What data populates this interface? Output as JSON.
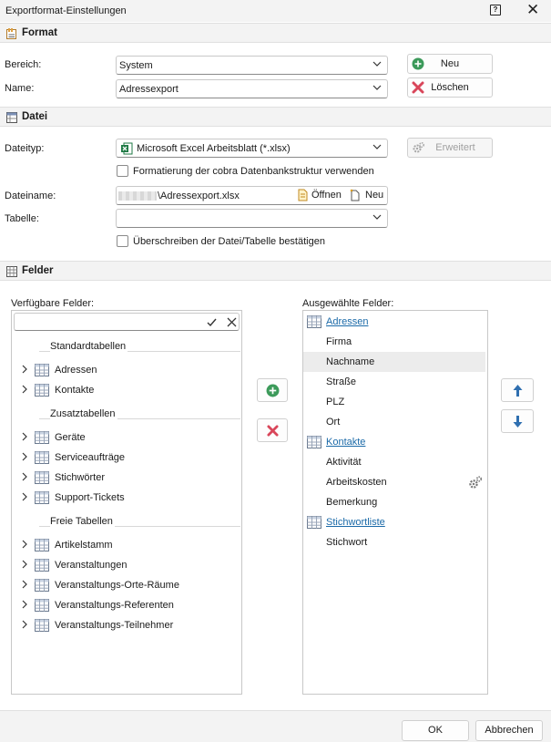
{
  "window": {
    "title": "Exportformat-Einstellungen",
    "help_label": "?",
    "close_label": "✕"
  },
  "format": {
    "header": "Format",
    "bereich_label": "Bereich:",
    "bereich_value": "System",
    "name_label": "Name:",
    "name_value": "Adressexport",
    "neu_label": "Neu",
    "loeschen_label": "Löschen"
  },
  "datei": {
    "header": "Datei",
    "dateityp_label": "Dateityp:",
    "dateityp_value": "Microsoft Excel Arbeitsblatt (*.xlsx)",
    "erweitert_label": "Erweitert",
    "formatierung_label": "Formatierung der cobra Datenbankstruktur verwenden",
    "dateiname_label": "Dateiname:",
    "dateiname_value": "\\Adressexport.xlsx",
    "oeffnen_label": "Öffnen",
    "neu_label": "Neu",
    "tabelle_label": "Tabelle:",
    "tabelle_value": "",
    "ueberschreiben_label": "Überschreiben der Datei/Tabelle bestätigen"
  },
  "felder": {
    "header": "Felder",
    "available_label": "Verfügbare Felder:",
    "selected_label": "Ausgewählte Felder:",
    "search_value": "",
    "groups": [
      {
        "name": "Standardtabellen",
        "items": [
          "Adressen",
          "Kontakte"
        ]
      },
      {
        "name": "Zusatztabellen",
        "items": [
          "Geräte",
          "Serviceaufträge",
          "Stichwörter",
          "Support-Tickets"
        ]
      },
      {
        "name": "Freie Tabellen",
        "items": [
          "Artikelstamm",
          "Veranstaltungen",
          "Veranstaltungs-Orte-Räume",
          "Veranstaltungs-Referenten",
          "Veranstaltungs-Teilnehmer"
        ]
      }
    ],
    "selected": [
      {
        "label": "Adressen",
        "header": true
      },
      {
        "label": "Firma"
      },
      {
        "label": "Nachname",
        "highlight": true
      },
      {
        "label": "Straße"
      },
      {
        "label": "PLZ"
      },
      {
        "label": "Ort"
      },
      {
        "label": "Kontakte",
        "header": true
      },
      {
        "label": "Aktivität"
      },
      {
        "label": "Arbeitskosten",
        "gear": true
      },
      {
        "label": "Bemerkung"
      },
      {
        "label": "Stichwortliste",
        "header": true
      },
      {
        "label": "Stichwort"
      }
    ]
  },
  "footer": {
    "ok_label": "OK",
    "abbrechen_label": "Abbrechen"
  },
  "colors": {
    "green": "#3c9a5a",
    "red": "#d9465a",
    "blue": "#2f6fb0",
    "link": "#1b6aa8"
  }
}
